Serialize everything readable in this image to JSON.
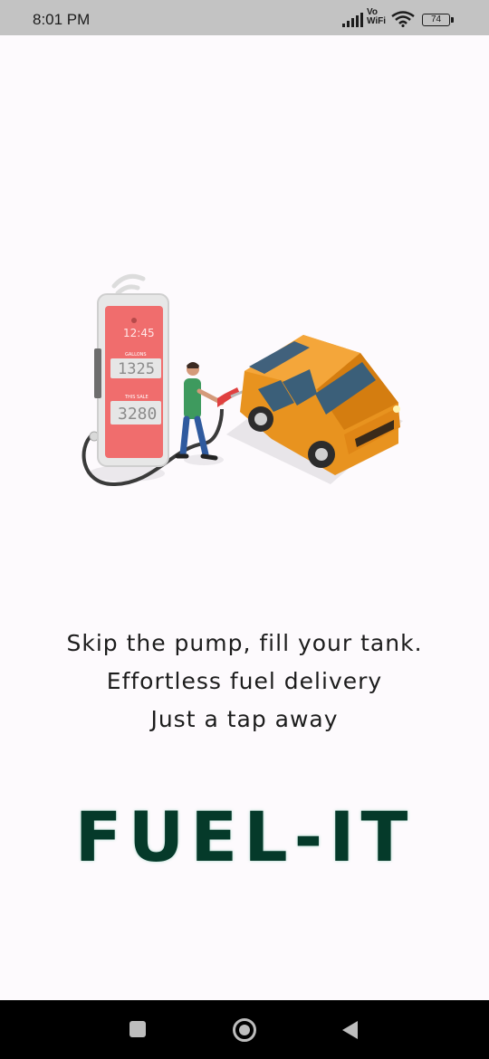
{
  "status_bar": {
    "time": "8:01 PM",
    "vowifi_top": "Vo",
    "vowifi_bottom": "WiFi",
    "battery": "74"
  },
  "illustration": {
    "pump_time": "12:45",
    "gallons_label": "GALLONS",
    "gallons_value": "1325",
    "sale_label": "THIS SALE",
    "sale_value": "3280"
  },
  "tagline": {
    "line1": "Skip the pump, fill your tank.",
    "line2": "Effortless fuel delivery",
    "line3": "Just a tap away"
  },
  "brand": {
    "name": "FUEL-IT"
  },
  "icons": {
    "nav_recent": "square-icon",
    "nav_home": "circle-home-icon",
    "nav_back": "triangle-back-icon"
  }
}
